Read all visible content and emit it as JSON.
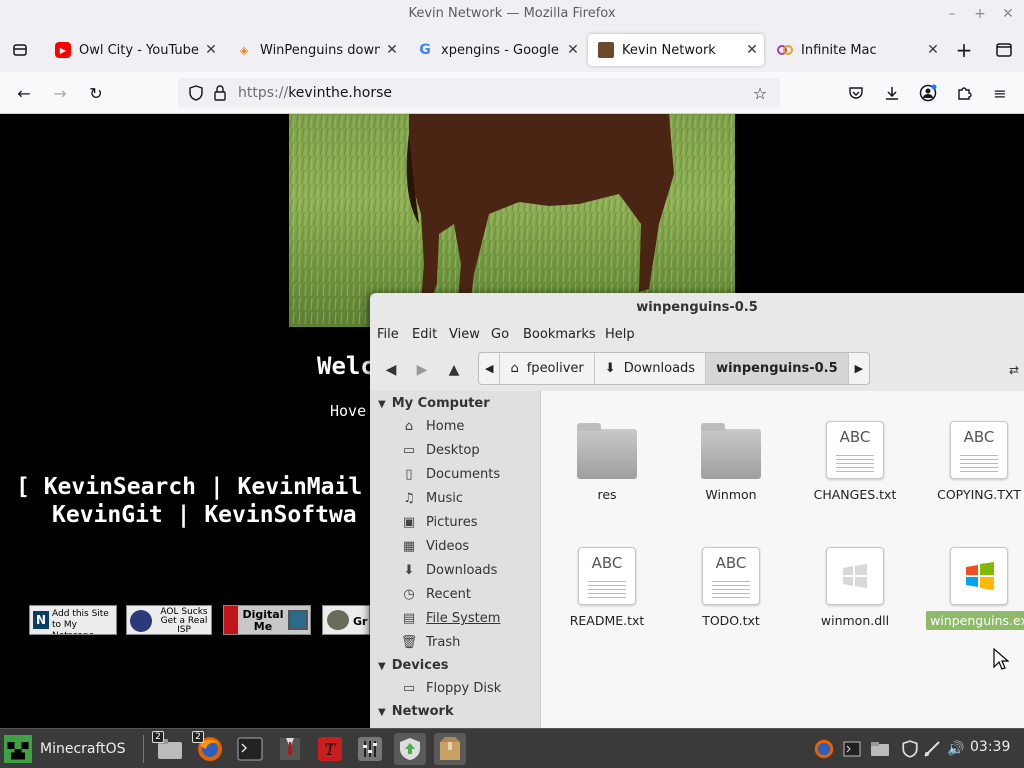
{
  "window": {
    "title": "Kevin Network — Mozilla Firefox"
  },
  "tabs": [
    {
      "label": "Owl City - YouTube",
      "active": false
    },
    {
      "label": "WinPenguins downl",
      "active": false
    },
    {
      "label": "xpengins - Google Se",
      "active": false
    },
    {
      "label": "Kevin Network",
      "active": true
    },
    {
      "label": "Infinite Mac",
      "active": false
    }
  ],
  "urlbar": {
    "protocol": "https://",
    "host": "kevinthe.horse"
  },
  "web": {
    "welcome": "Welc",
    "hover": "Hove",
    "links_line1": "[ KevinSearch | KevinMail",
    "links_line2": "KevinGit | KevinSoftwa",
    "badges": [
      {
        "text": "Add this Site to My Netscape"
      },
      {
        "text": "AOL Sucks Get a Real ISP"
      },
      {
        "text": "Digital Me"
      },
      {
        "text": "Gr"
      }
    ]
  },
  "filemanager": {
    "title": "winpenguins-0.5",
    "menu": [
      "File",
      "Edit",
      "View",
      "Go",
      "Bookmarks",
      "Help"
    ],
    "breadcrumbs": [
      "fpeoliver",
      "Downloads",
      "winpenguins-0.5"
    ],
    "sidebar": {
      "my_computer": "My Computer",
      "places": [
        "Home",
        "Desktop",
        "Documents",
        "Music",
        "Pictures",
        "Videos",
        "Downloads",
        "Recent",
        "File System",
        "Trash"
      ],
      "devices": "Devices",
      "device_items": [
        "Floppy Disk"
      ],
      "network": "Network"
    },
    "files": [
      {
        "name": "res",
        "kind": "folder"
      },
      {
        "name": "Winmon",
        "kind": "folder"
      },
      {
        "name": "CHANGES.txt",
        "kind": "text"
      },
      {
        "name": "COPYING.TXT",
        "kind": "text"
      },
      {
        "name": "README.txt",
        "kind": "text"
      },
      {
        "name": "TODO.txt",
        "kind": "text"
      },
      {
        "name": "winmon.dll",
        "kind": "dll"
      },
      {
        "name": "winpenguins.ex",
        "kind": "exe",
        "selected": true
      }
    ],
    "doc_icon_text": "ABC"
  },
  "taskbar": {
    "start_label": "MinecraftOS",
    "group_counts": [
      "2",
      "2"
    ],
    "clock": "03:39"
  }
}
